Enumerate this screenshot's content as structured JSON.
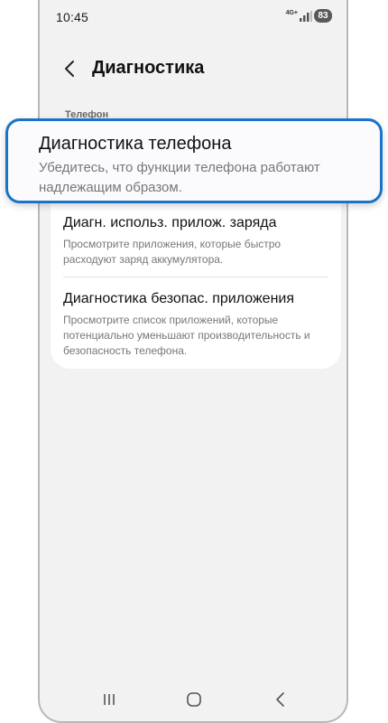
{
  "status_bar": {
    "time": "10:45",
    "network": "4G+",
    "battery": "83"
  },
  "header": {
    "title": "Диагностика",
    "back_icon": "chevron-left-icon"
  },
  "section": {
    "label": "Телефон"
  },
  "highlighted_item": {
    "title": "Диагностика телефона",
    "description": "Убедитесь, что функции телефона работают надлежащим образом."
  },
  "items": [
    {
      "title": "Диагн. использ. прилож. заряда",
      "description": "Просмотрите приложения, которые быстро расходуют заряд аккумулятора."
    },
    {
      "title": "Диагностика безопас. приложения",
      "description": "Просмотрите список приложений, которые потенциально уменьшают производительность и безопасность телефона."
    }
  ],
  "nav_bar": {
    "recents_icon": "recents-icon",
    "home_icon": "home-icon",
    "back_icon": "back-icon"
  },
  "colors": {
    "highlight_border": "#1a73c8",
    "background": "#f2f2f2",
    "card": "#ffffff"
  }
}
